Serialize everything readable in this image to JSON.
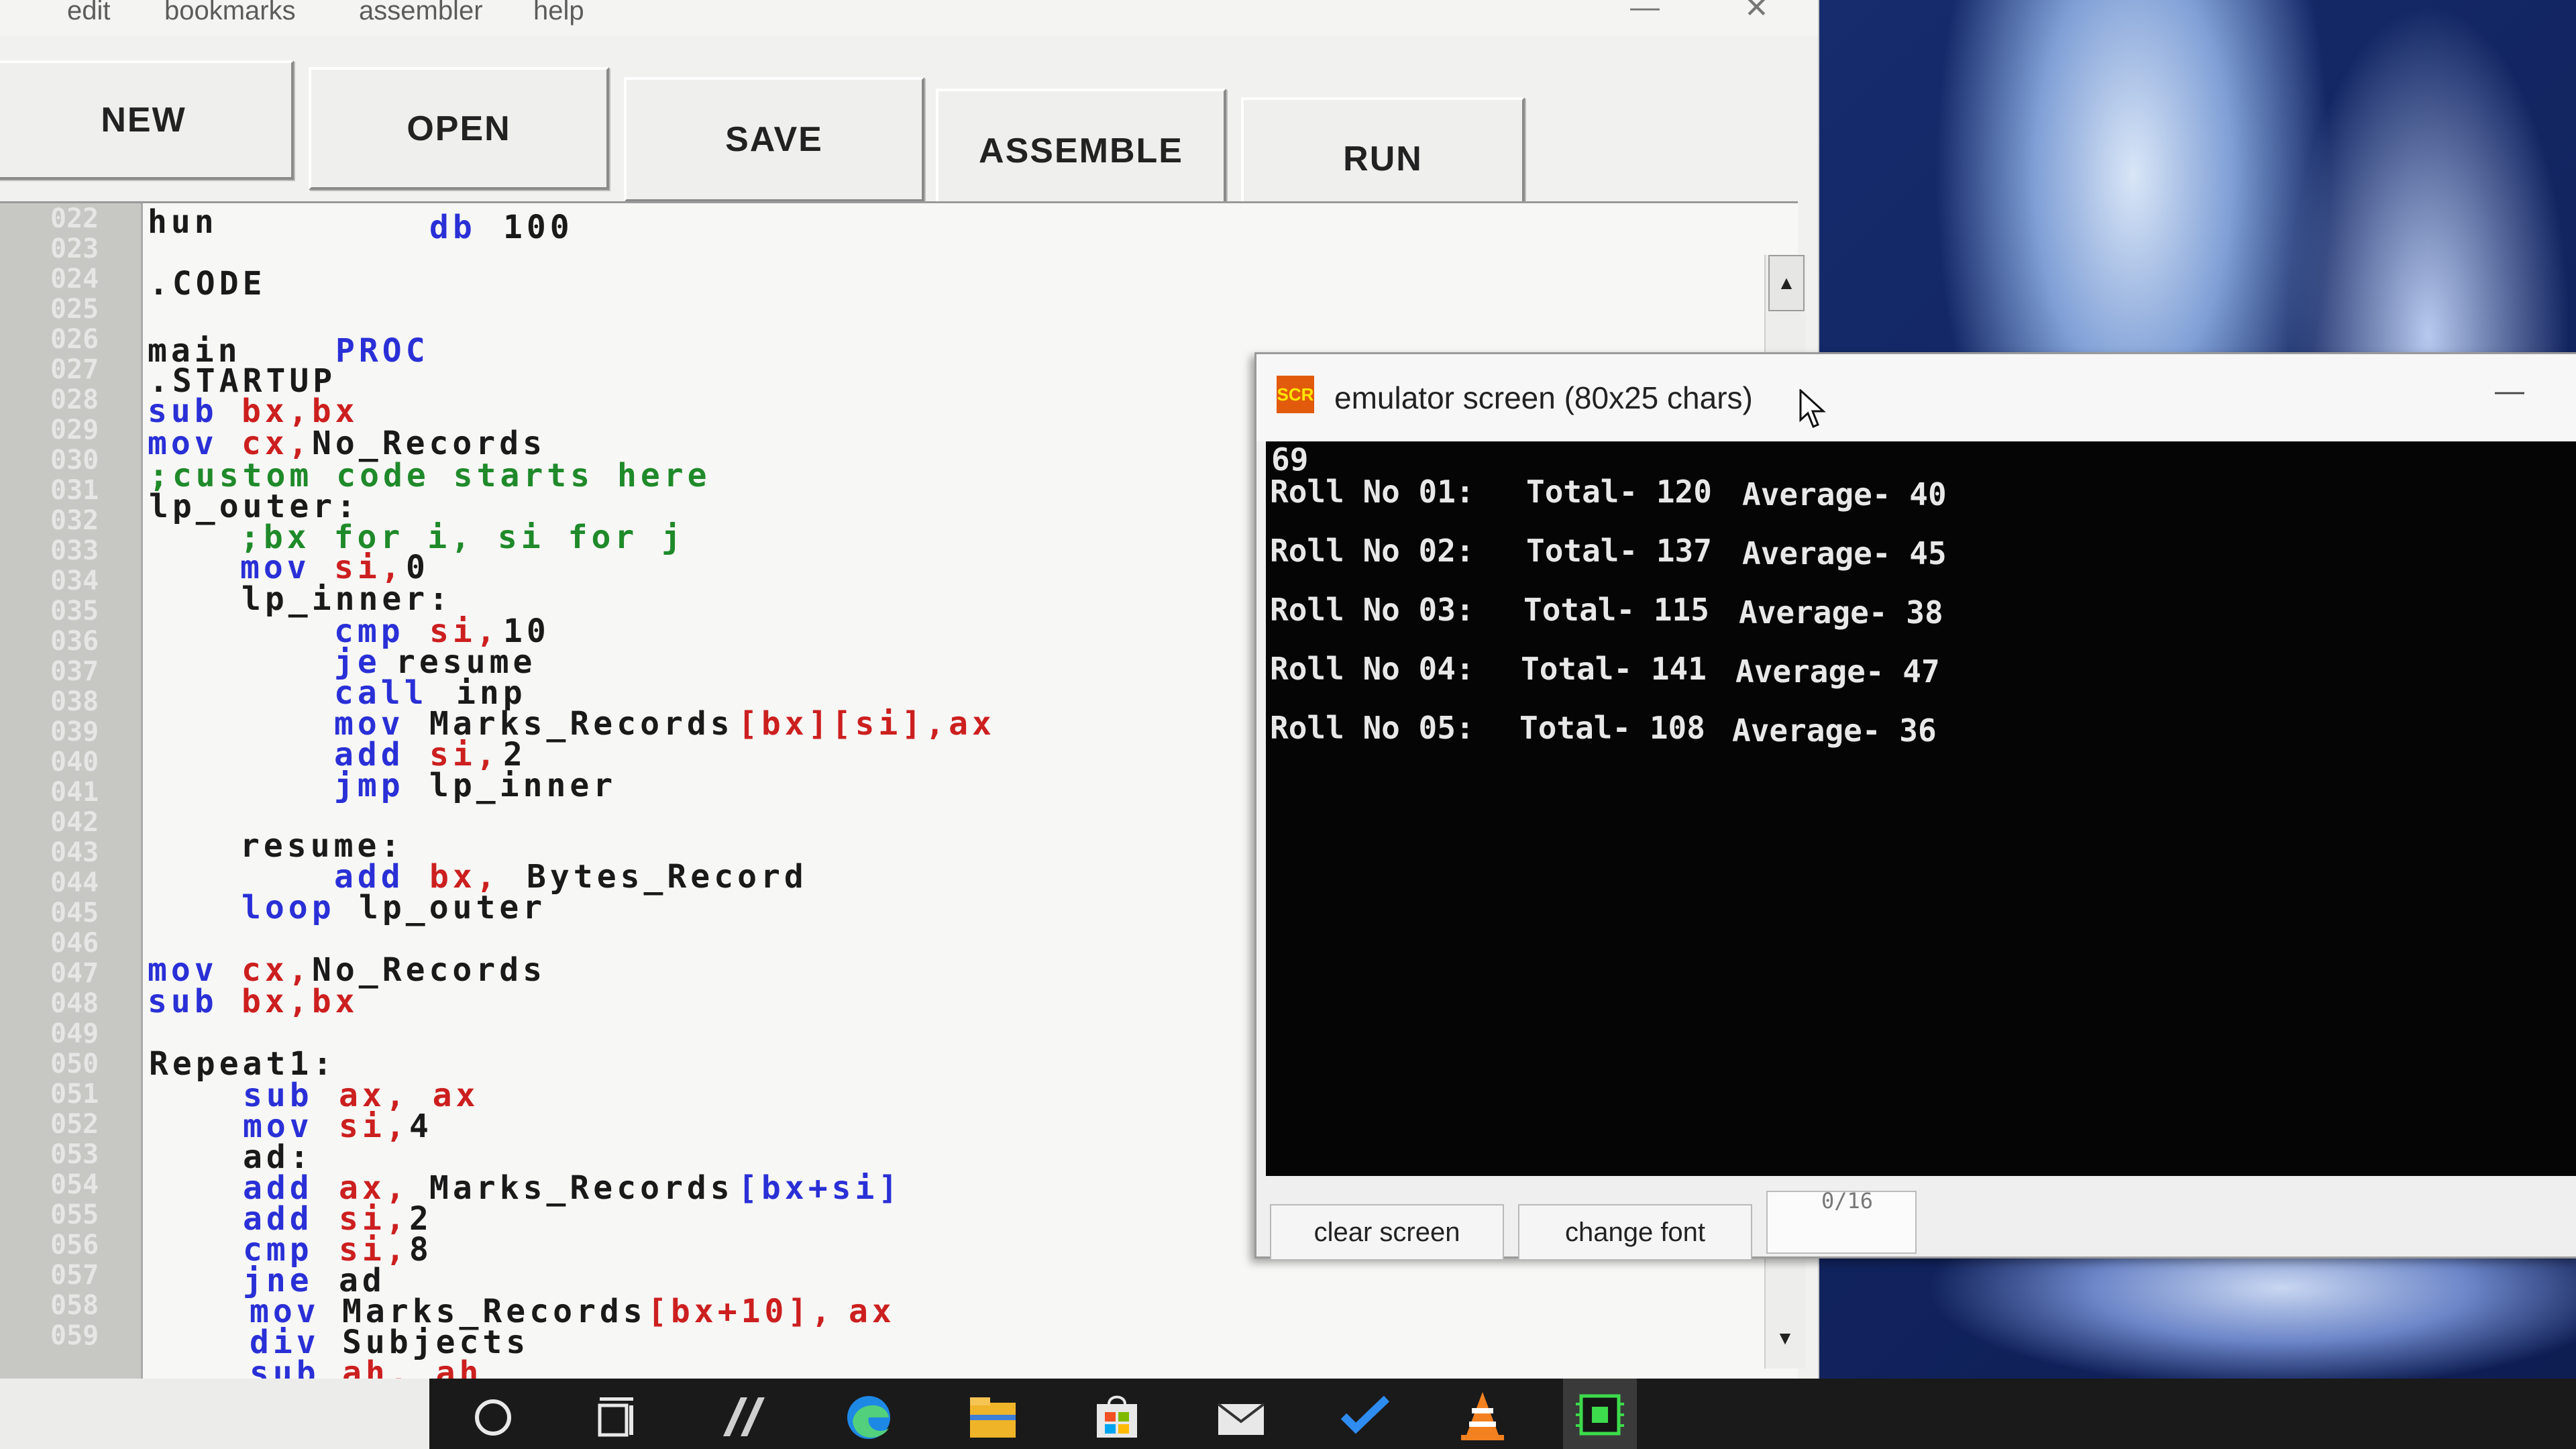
{
  "menubar": {
    "items": [
      "edit",
      "bookmarks",
      "assembler",
      "help"
    ],
    "minimize": "—",
    "close": "✕"
  },
  "toolbar": {
    "new_label": "NEW",
    "open_label": "OPEN",
    "save_label": "SAVE",
    "assemble_label": "ASSEMBLE",
    "run_label": "RUN"
  },
  "editor": {
    "line_numbers": [
      "022",
      "023",
      "024",
      "025",
      "026",
      "027",
      "028",
      "029",
      "030",
      "031",
      "032",
      "033",
      "034",
      "035",
      "036",
      "037",
      "038",
      "039",
      "040",
      "041",
      "042",
      "043",
      "044",
      "045",
      "046",
      "047",
      "048",
      "049",
      "050",
      "051",
      "052",
      "053",
      "054",
      "055",
      "056",
      "057",
      "058",
      "059"
    ],
    "lines": {
      "l022a": "hun",
      "l022b": "db",
      "l022c": "100",
      "l024": ".CODE",
      "l026a": "main",
      "l026b": "PROC",
      "l027": ".STARTUP",
      "l028a": "sub",
      "l028b": "bx,bx",
      "l029a": "mov",
      "l029b": "cx,",
      "l029c": "No_Records",
      "l030": ";custom code starts here",
      "l031": "lp_outer:",
      "l032": ";bx for i, si for j",
      "l033a": "mov",
      "l033b": "si,",
      "l033c": "0",
      "l034": "lp_inner:",
      "l035a": "cmp",
      "l035b": "si,",
      "l035c": "10",
      "l036a": "je",
      "l036b": "resume",
      "l037a": "call",
      "l037b": "inp",
      "l038a": "mov",
      "l038b": "Marks_Records",
      "l038c": "[bx][si],ax",
      "l039a": "add",
      "l039b": "si,",
      "l039c": "2",
      "l040a": "jmp",
      "l040b": "lp_inner",
      "l042": "resume:",
      "l043a": "add",
      "l043b": "bx,",
      "l043c": "Bytes_Record",
      "l044a": "loop",
      "l044b": "lp_outer",
      "l046a": "mov",
      "l046b": "cx,",
      "l046c": "No_Records",
      "l047a": "sub",
      "l047b": "bx,bx",
      "l049": "Repeat1:",
      "l050a": "sub",
      "l050b": "ax, ax",
      "l051a": "mov",
      "l051b": "si,",
      "l051c": "4",
      "l052": "ad:",
      "l053a": "add",
      "l053b": "ax,",
      "l053c": "Marks_Records",
      "l053d": "[bx+si]",
      "l054a": "add",
      "l054b": "si,",
      "l054c": "2",
      "l055a": "cmp",
      "l055b": "si,",
      "l055c": "8",
      "l056a": "jne",
      "l056b": "ad",
      "l057a": "mov",
      "l057b": "Marks_Records",
      "l057c": "[bx+10],",
      "l057d": "ax",
      "l058a": "div",
      "l058b": "Subjects",
      "l059a": "sub",
      "l059b": "ah, ah"
    }
  },
  "emulator": {
    "title": "emulator screen (80x25 chars)",
    "icon_text": "SCR",
    "minimize": "—",
    "first_line": "69",
    "rows": [
      {
        "label": "Roll No 01:",
        "total": "Total- 120",
        "average": "Average- 40"
      },
      {
        "label": "Roll No 02:",
        "total": "Total- 137",
        "average": "Average- 45"
      },
      {
        "label": "Roll No 03:",
        "total": "Total- 115",
        "average": "Average- 38"
      },
      {
        "label": "Roll No 04:",
        "total": "Total- 141",
        "average": "Average- 47"
      },
      {
        "label": "Roll No 05:",
        "total": "Total- 108",
        "average": "Average- 36"
      }
    ],
    "clear_label": "clear screen",
    "font_label": "change font",
    "counter": "0/16"
  },
  "taskbar": {
    "icons": [
      "search-icon",
      "task-view-icon",
      "pen-app-icon",
      "edge-browser-icon",
      "file-explorer-icon",
      "store-icon",
      "mail-icon",
      "todo-icon",
      "vlc-icon",
      "emu8086-icon"
    ]
  },
  "colors": {
    "keyword": "#2a30d6",
    "register": "#cc1f1f",
    "comment": "#1f8a2a",
    "label": "#1a1a1a"
  }
}
